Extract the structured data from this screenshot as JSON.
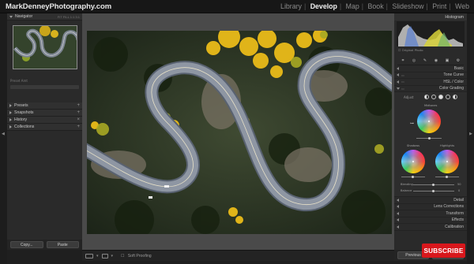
{
  "brand": "MarkDenneyPhotography.com",
  "modules": [
    {
      "label": "Library",
      "active": false
    },
    {
      "label": "Develop",
      "active": true
    },
    {
      "label": "Map",
      "active": false
    },
    {
      "label": "Book",
      "active": false
    },
    {
      "label": "Slideshow",
      "active": false
    },
    {
      "label": "Print",
      "active": false
    },
    {
      "label": "Web",
      "active": false
    }
  ],
  "left_panel": {
    "navigator_title": "Navigator",
    "navigator_options": "FIT  FILL  1:1  3:1",
    "preset_label": "Preset  Amt",
    "sections": [
      "Presets",
      "Snapshots",
      "History",
      "Collections"
    ],
    "copy_button": "Copy...",
    "paste_button": "Paste"
  },
  "toolbar": {
    "soft_proofing": "Soft Proofing"
  },
  "right_panel": {
    "histogram_title": "Histogram",
    "original_photo": "Original Photo",
    "sections_top": [
      "Basic",
      "Tone Curve",
      "HSL / Color",
      "Color Grading"
    ],
    "color_grading": {
      "adjust_label": "Adjust",
      "midtones": "Midtones",
      "shadows": "Shadows",
      "highlights": "Highlights",
      "blending": "Blending",
      "balance": "Balance",
      "blending_value": "50",
      "balance_value": "0"
    },
    "sections_bottom": [
      "Detail",
      "Lens Corrections",
      "Transform",
      "Effects",
      "Calibration"
    ],
    "previous_button": "Previous",
    "reset_button": "Reset"
  },
  "subscribe_label": "SUBSCRIBE",
  "colors": {
    "accent_red": "#d8171c",
    "panel_bg": "#2a2a2a",
    "center_bg": "#4a4a4a"
  }
}
